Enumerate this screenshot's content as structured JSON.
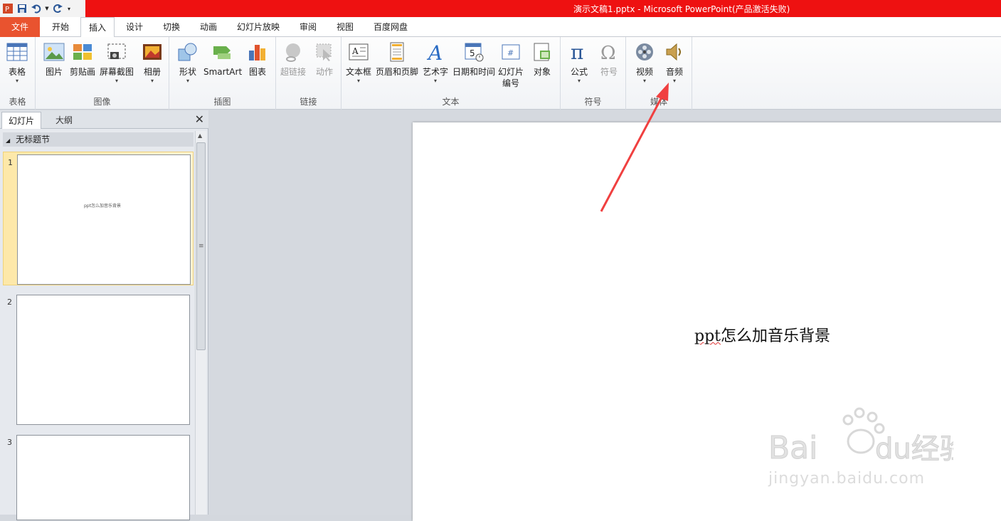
{
  "window": {
    "title": "演示文稿1.pptx - Microsoft PowerPoint(产品激活失败)"
  },
  "tabs": {
    "file": "文件",
    "home": "开始",
    "insert": "插入",
    "design": "设计",
    "transitions": "切换",
    "animations": "动画",
    "slideshow": "幻灯片放映",
    "review": "审阅",
    "view": "视图",
    "baidu": "百度网盘"
  },
  "ribbon": {
    "groups": {
      "tables": "表格",
      "images": "图像",
      "illustrations": "插图",
      "links": "链接",
      "text": "文本",
      "symbols": "符号",
      "media": "媒体"
    },
    "buttons": {
      "table": "表格",
      "picture": "图片",
      "clipart": "剪贴画",
      "screenshot": "屏幕截图",
      "album": "相册",
      "shapes": "形状",
      "smartart": "SmartArt",
      "chart": "图表",
      "hyperlink": "超链接",
      "action": "动作",
      "textbox": "文本框",
      "header_footer": "页眉和页脚",
      "wordart": "艺术字",
      "datetime": "日期和时间",
      "slide_number_1": "幻灯片",
      "slide_number_2": "编号",
      "object": "对象",
      "equation": "公式",
      "symbol": "符号",
      "video": "视频",
      "audio": "音频"
    }
  },
  "left_pane": {
    "tab_slides": "幻灯片",
    "tab_outline": "大纲",
    "close": "✕",
    "section": "无标题节",
    "thumbnails": [
      {
        "number": "1",
        "text": "ppt怎么加音乐背景"
      },
      {
        "number": "2",
        "text": ""
      },
      {
        "number": "3",
        "text": ""
      }
    ]
  },
  "slide": {
    "text_prefix": "ppt",
    "text_rest": "怎么加音乐背景"
  },
  "watermark": {
    "brand": "Baidu经验",
    "url": "jingyan.baidu.com"
  },
  "colors": {
    "title_bar": "#ee1111",
    "file_tab": "#e9532f",
    "arrow": "#f04040"
  }
}
